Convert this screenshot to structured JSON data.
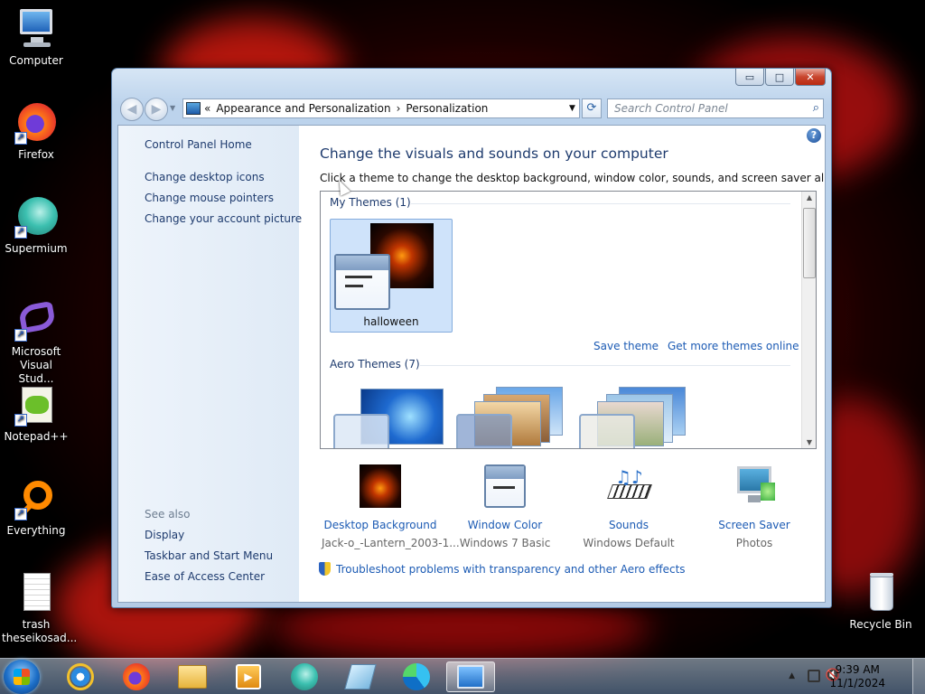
{
  "desktop": {
    "icons": [
      {
        "label": "Computer",
        "icon": "computer-icon"
      },
      {
        "label": "Firefox",
        "icon": "firefox-icon"
      },
      {
        "label": "Supermium",
        "icon": "supermium-icon"
      },
      {
        "label": "Microsoft Visual Stud...",
        "icon": "visual-studio-icon"
      },
      {
        "label": "Notepad++",
        "icon": "notepadpp-icon"
      },
      {
        "label": "Everything",
        "icon": "everything-icon"
      },
      {
        "label": "trash theseikosad...",
        "icon": "text-file-icon"
      },
      {
        "label": "Recycle Bin",
        "icon": "recycle-bin-icon"
      }
    ]
  },
  "window": {
    "controls": {
      "minimize": "▭",
      "maximize": "□",
      "close": "✕"
    },
    "address": {
      "prefix": "«",
      "crumbs": [
        "Appearance and Personalization",
        "Personalization"
      ],
      "sep": "›"
    },
    "search_placeholder": "Search Control Panel",
    "left_nav": {
      "home": "Control Panel Home",
      "links": [
        "Change desktop icons",
        "Change mouse pointers",
        "Change your account picture"
      ],
      "see_also_heading": "See also",
      "see_also": [
        "Display",
        "Taskbar and Start Menu",
        "Ease of Access Center"
      ]
    },
    "main": {
      "title": "Change the visuals and sounds on your computer",
      "description": "Click a theme to change the desktop background, window color, sounds, and screen saver all at once.",
      "my_themes_heading": "My Themes (1)",
      "selected_theme": "halloween",
      "save_theme": "Save theme",
      "get_more": "Get more themes online",
      "aero_heading": "Aero Themes (7)",
      "settings": [
        {
          "title": "Desktop Background",
          "value": "Jack-o_-Lantern_2003-1...",
          "icon": "pumpkin-icon"
        },
        {
          "title": "Window Color",
          "value": "Windows 7 Basic",
          "icon": "window-color-icon"
        },
        {
          "title": "Sounds",
          "value": "Windows Default",
          "icon": "sounds-icon"
        },
        {
          "title": "Screen Saver",
          "value": "Photos",
          "icon": "screen-saver-icon"
        }
      ],
      "troubleshoot": "Troubleshoot problems with transparency and other Aero effects"
    }
  },
  "taskbar": {
    "apps": [
      "internet-explorer",
      "firefox",
      "file-explorer",
      "media-player",
      "supermium",
      "vmware",
      "edge",
      "control-panel"
    ],
    "time": "9:39 AM",
    "date": "11/1/2024"
  }
}
